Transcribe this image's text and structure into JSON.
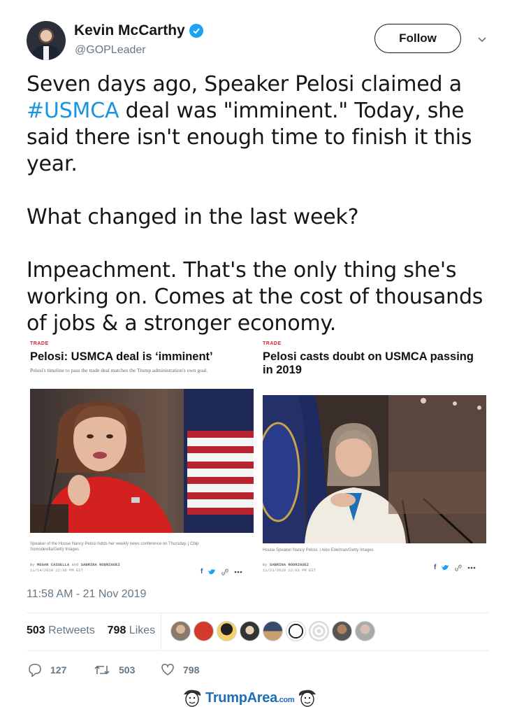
{
  "author": {
    "name": "Kevin McCarthy",
    "handle": "@GOPLeader",
    "verified": true
  },
  "follow_label": "Follow",
  "tweet": {
    "lines": [
      [
        "Seven days ago, Speaker Pelosi claimed a"
      ],
      [
        "#USMCA",
        " deal was \"imminent.\" Today, she"
      ],
      [
        "said there isn't enough time to finish it this"
      ],
      [
        "year."
      ],
      [
        "What changed in the last week?"
      ],
      [
        "Impeachment. That's the only thing she's"
      ],
      [
        "working on. Comes at the cost of thousands"
      ],
      [
        "of jobs & a stronger economy."
      ]
    ],
    "hashtag_color": "#1b95e0"
  },
  "cards": [
    {
      "kicker": "TRADE",
      "headline": "Pelosi: USMCA deal is ‘imminent’",
      "dek": "Pelosi's timeline to pass the trade deal matches the Trump administration's own goal.",
      "caption": "Speaker of the House Nancy Pelosi holds her weekly news conference on Thursday. | Chip Somodevilla/Getty Images",
      "byline_prefix": "By",
      "author1": "MEGAN CASSELLA",
      "and": "and",
      "author2": "SABRINA RODRIGUEZ",
      "date": "11/14/2019 12:36 PM EST"
    },
    {
      "kicker": "TRADE",
      "headline": "Pelosi casts doubt on USMCA passing in 2019",
      "caption": "House Speaker Nancy Pelosi. | Alex Edelman/Getty Images",
      "byline_prefix": "By",
      "author1": "SABRINA RODRIGUEZ",
      "date": "11/21/2019 12:03 PM EST"
    }
  ],
  "share_icons": [
    "facebook-icon",
    "twitter-icon",
    "link-icon",
    "more-icon"
  ],
  "timestamp": "11:58 AM - 21 Nov 2019",
  "stats": {
    "retweets": "503",
    "retweets_label": "Retweets",
    "likes": "798",
    "likes_label": "Likes"
  },
  "actions": {
    "replies": "127",
    "retweets": "503",
    "likes": "798"
  },
  "watermark": {
    "text": "TrumpArea",
    "suffix": ".com"
  },
  "colors": {
    "accent": "#1da1f2",
    "muted": "#657786",
    "kicker_red": "#d0262e"
  }
}
